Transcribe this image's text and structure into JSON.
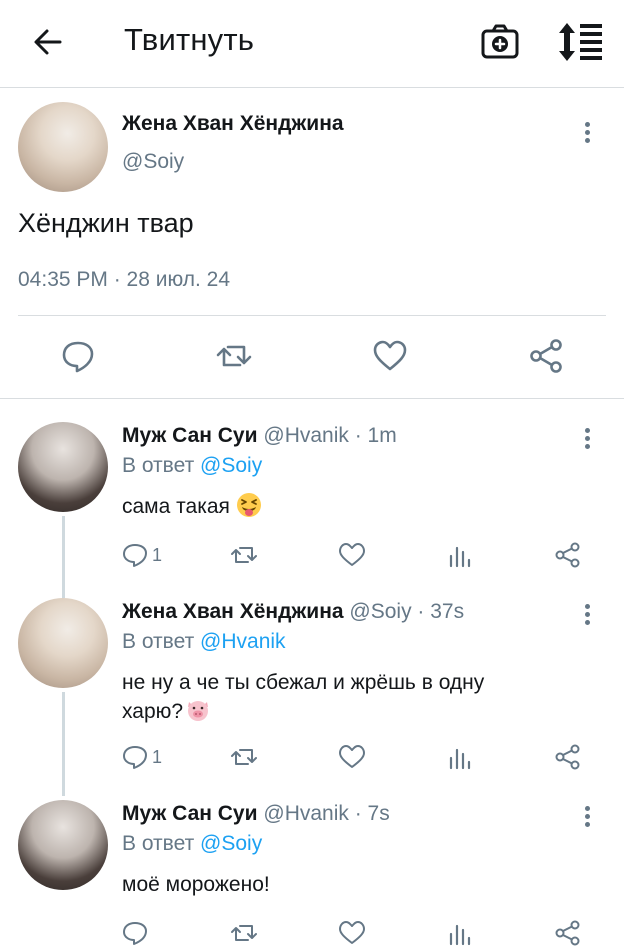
{
  "header": {
    "title": "Твитнуть"
  },
  "main_tweet": {
    "author_name": "Жена Хван Хёнджина",
    "handle": "@Soiy",
    "text": "Хёнджин твар",
    "timestamp": "04:35 PM · 28 июл. 24"
  },
  "replies": [
    {
      "author_name": "Муж Сан Суи",
      "handle_time": "@Hvanik · 1m",
      "in_reply_prefix": "В ответ",
      "in_reply_to": "@Soiy",
      "text": "сама такая",
      "emoji": "squinting-tongue-face",
      "reply_count": "1"
    },
    {
      "author_name": "Жена Хван Хёнджина",
      "handle_time": "@Soiy · 37s",
      "in_reply_prefix": "В ответ",
      "in_reply_to": "@Hvanik",
      "text_line1": "не ну а че ты сбежал и жрёшь в одну",
      "text_line2": "харю?",
      "emoji": "pig-face",
      "reply_count": "1"
    },
    {
      "author_name": "Муж Сан Суи",
      "handle_time": "@Hvanik · 7s",
      "in_reply_prefix": "В ответ",
      "in_reply_to": "@Soiy",
      "text": "моё морожено!",
      "reply_count": ""
    }
  ],
  "icons": {
    "back": "arrow-left-icon",
    "camera": "camera-plus-icon",
    "sort": "sort-icon",
    "reply": "reply-icon",
    "retweet": "retweet-icon",
    "like": "heart-icon",
    "views": "analytics-icon",
    "share": "share-icon"
  },
  "colors": {
    "accent": "#1da1f2",
    "muted": "#657786",
    "text": "#14171a",
    "divider": "#d9dde0"
  }
}
